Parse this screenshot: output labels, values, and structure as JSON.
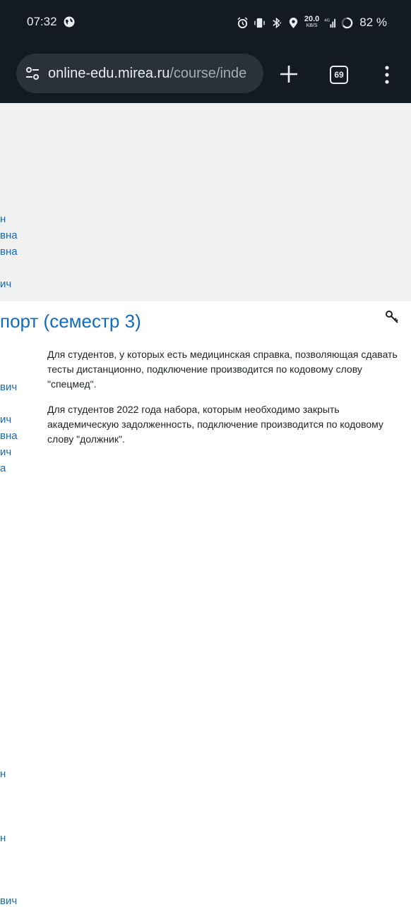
{
  "status_bar": {
    "time": "07:32",
    "net_speed_value": "20.0",
    "net_speed_unit": "KB/S",
    "network_type": "4G",
    "battery": "82 %"
  },
  "browser": {
    "url_main": "online-edu.mirea.ru",
    "url_path": "/course/inde",
    "tab_count": "69"
  },
  "sidebar_fragments": [
    "н",
    "вна",
    "вна",
    "ич",
    "вич",
    "ич",
    "вна",
    "ич",
    "а",
    "н",
    "н",
    "вич"
  ],
  "course": {
    "title_fragment": "порт (семестр 3)",
    "paragraphs": [
      "Для студентов, у которых есть медицинская справка, позволяющая сдавать тесты дистанционно, подключение производится по кодовому слову \"спецмед\".",
      "Для студентов 2022 года набора, которым необходимо закрыть академическую задолженность, подключение производится по кодовому слову \"должник\"."
    ]
  },
  "colors": {
    "link": "#0f6cbf",
    "browser_bg": "#141a22",
    "urlbar_bg": "#2a313b",
    "panel_bg": "#f1f1f1"
  },
  "icons": [
    "globe-icon",
    "alarm-icon",
    "vibrate-icon",
    "bluetooth-icon",
    "location-icon",
    "signal-icon",
    "battery-ring-icon",
    "site-settings-icon",
    "new-tab-icon",
    "tab-switcher-icon",
    "more-menu-icon",
    "key-icon"
  ]
}
